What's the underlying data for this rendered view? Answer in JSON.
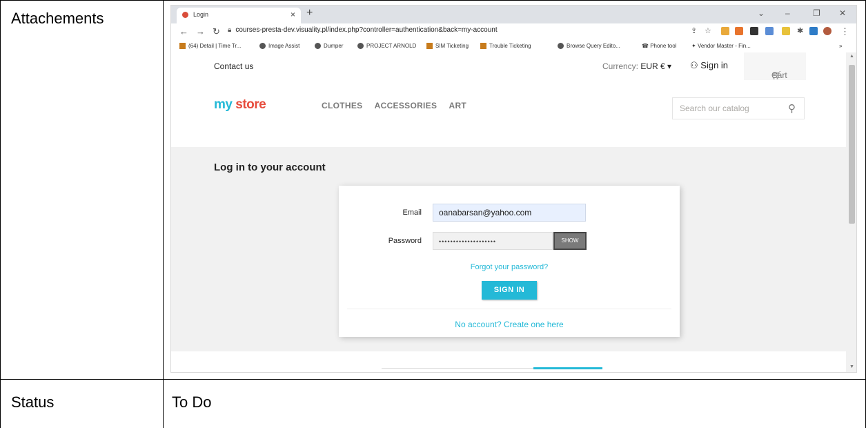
{
  "table": {
    "attachments_label": "Attachements",
    "status_label": "Status",
    "status_value": "To Do"
  },
  "browser": {
    "tab_title": "Login",
    "url": "courses-presta-dev.visuality.pl/index.php?controller=authentication&back=my-account",
    "bookmarks": [
      "(64) Detail | Time Tr...",
      "Image Assist",
      "Dumper",
      "PROJECT ARNOLD",
      "SIM Ticketing",
      "Trouble Ticketing",
      "Browse Query Edito...",
      "Phone tool",
      "Vendor Master - Fin..."
    ],
    "bookmarks_more": "»"
  },
  "site": {
    "contact": "Contact us",
    "currency_label": "Currency:",
    "currency_value": "EUR € ▾",
    "signin": "Sign in",
    "cart": "Cart (0)",
    "logo_a": "my ",
    "logo_b": "store",
    "menu": [
      "CLOTHES",
      "ACCESSORIES",
      "ART"
    ],
    "search_placeholder": "Search our catalog",
    "page_title": "Log in to your account",
    "email_label": "Email",
    "email_value": "oanabarsan@yahoo.com",
    "password_label": "Password",
    "password_value": "••••••••••••••••••••",
    "show_label": "SHOW",
    "forgot": "Forgot your password?",
    "signin_button": "SIGN IN",
    "no_account": "No account? Create one here"
  }
}
